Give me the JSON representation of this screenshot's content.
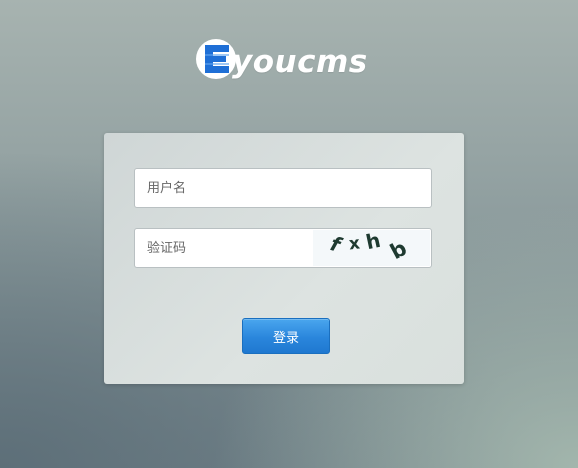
{
  "logo": {
    "text": "youcms",
    "badge_letter": "E",
    "badge_color": "#1f6fd6"
  },
  "login": {
    "username_placeholder": "用户名",
    "captcha_placeholder": "验证码",
    "captcha_chars": [
      "f",
      "x",
      "h",
      "b"
    ],
    "submit_label": "登录"
  },
  "colors": {
    "accent": "#2a86dc",
    "card": "#d6dcdc"
  }
}
